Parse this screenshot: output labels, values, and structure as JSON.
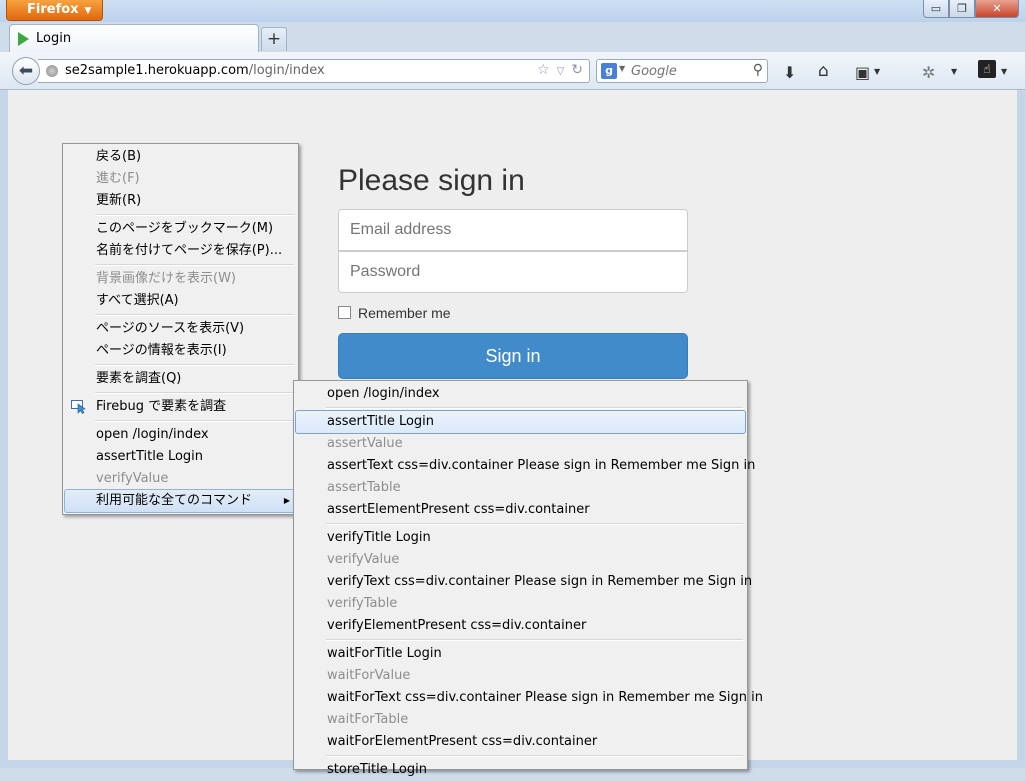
{
  "browser": {
    "app_button": "Firefox",
    "window_controls": {
      "minimize": "▭",
      "maximize": "❐",
      "close": "✕"
    },
    "tab": {
      "title": "Login"
    },
    "new_tab": "+",
    "url": {
      "host": "se2sample1.herokuapp.com",
      "path": "/login/index"
    },
    "search": {
      "engine_icon": "g",
      "placeholder": "Google"
    }
  },
  "page": {
    "heading": "Please sign in",
    "email_placeholder": "Email address",
    "password_placeholder": "Password",
    "remember_label": "Remember me",
    "signin_label": "Sign in"
  },
  "context_menu": {
    "items": [
      {
        "label": "戻る(B)",
        "disabled": false
      },
      {
        "label": "進む(F)",
        "disabled": true
      },
      {
        "label": "更新(R)",
        "disabled": false
      },
      {
        "label": "このページをブックマーク(M)",
        "disabled": false
      },
      {
        "label": "名前を付けてページを保存(P)...",
        "disabled": false
      },
      {
        "label": "背景画像だけを表示(W)",
        "disabled": true
      },
      {
        "label": "すべて選択(A)",
        "disabled": false
      },
      {
        "label": "ページのソースを表示(V)",
        "disabled": false
      },
      {
        "label": "ページの情報を表示(I)",
        "disabled": false
      },
      {
        "label": "要素を調査(Q)",
        "disabled": false
      },
      {
        "label": "Firebug で要素を調査",
        "disabled": false
      },
      {
        "label": "open /login/index",
        "disabled": false
      },
      {
        "label": "assertTitle Login",
        "disabled": false
      },
      {
        "label": "verifyValue",
        "disabled": true
      },
      {
        "label": "利用可能な全てのコマンド",
        "disabled": false
      }
    ]
  },
  "submenu": {
    "items": [
      {
        "label": "open /login/index",
        "disabled": false
      },
      {
        "label": "assertTitle Login",
        "disabled": false
      },
      {
        "label": "assertValue",
        "disabled": true
      },
      {
        "label": "assertText css=div.container Please sign in Remember me Sign in",
        "disabled": false
      },
      {
        "label": "assertTable",
        "disabled": true
      },
      {
        "label": "assertElementPresent css=div.container",
        "disabled": false
      },
      {
        "label": "verifyTitle Login",
        "disabled": false
      },
      {
        "label": "verifyValue",
        "disabled": true
      },
      {
        "label": "verifyText css=div.container Please sign in Remember me Sign in",
        "disabled": false
      },
      {
        "label": "verifyTable",
        "disabled": true
      },
      {
        "label": "verifyElementPresent css=div.container",
        "disabled": false
      },
      {
        "label": "waitForTitle Login",
        "disabled": false
      },
      {
        "label": "waitForValue",
        "disabled": true
      },
      {
        "label": "waitForText css=div.container Please sign in Remember me Sign in",
        "disabled": false
      },
      {
        "label": "waitForTable",
        "disabled": true
      },
      {
        "label": "waitForElementPresent css=div.container",
        "disabled": false
      },
      {
        "label": "storeTitle Login",
        "disabled": false
      }
    ]
  }
}
